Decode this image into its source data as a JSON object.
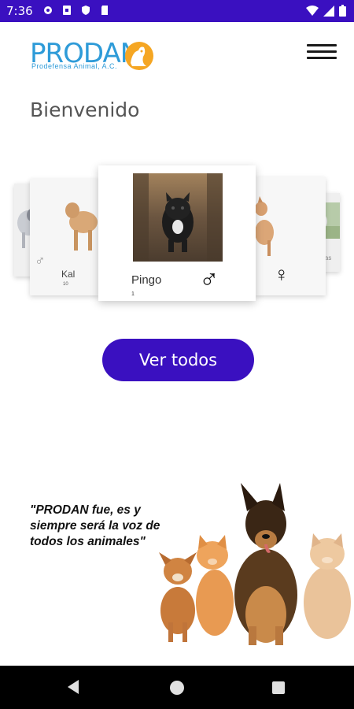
{
  "status_bar": {
    "time": "7:36",
    "left_icons": [
      "settings-icon",
      "sim-icon",
      "shield-icon",
      "sd-card-icon"
    ],
    "right_icons": [
      "wifi-icon",
      "signal-icon",
      "battery-icon"
    ],
    "background": "#3a10c0"
  },
  "header": {
    "logo_text": "PRODAN",
    "logo_subtitle": "Prodefensa Animal, A.C.",
    "logo_mark": "dog-cat-logo-icon",
    "menu_icon": "hamburger-menu-icon"
  },
  "main": {
    "title": "Bienvenido",
    "carousel": {
      "cards": [
        {
          "position": "far-left",
          "gender_symbol": "♂"
        },
        {
          "position": "left",
          "name": "Kal",
          "age": "10"
        },
        {
          "position": "center",
          "name": "Pingo",
          "age": "1",
          "gender_symbol": "♂"
        },
        {
          "position": "right",
          "gender_symbol": "♀"
        },
        {
          "position": "far-right",
          "name": "Douglas"
        }
      ]
    },
    "view_all_label": "Ver todos",
    "quote": "\"PRODAN fue, es y siempre será la voz de todos los animales\""
  },
  "colors": {
    "accent": "#3a10c0",
    "logo_blue": "#2e9bd8",
    "logo_orange": "#f5a623"
  },
  "nav_bar": {
    "icons": [
      "back-icon",
      "home-icon",
      "recents-icon"
    ]
  }
}
